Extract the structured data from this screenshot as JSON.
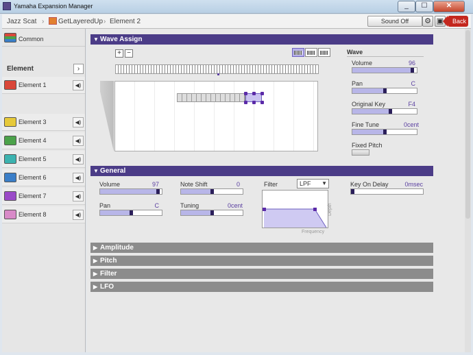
{
  "window": {
    "title": "Yamaha Expansion Manager",
    "min": "_",
    "max": "☐",
    "close": "✕"
  },
  "breadcrumb": {
    "root": "Jazz Scat",
    "item": "GetLayeredUp",
    "current": "Element 2",
    "sep": "›"
  },
  "toolbar": {
    "sound_off": "Sound Off",
    "gear": "⚙",
    "save": "▣",
    "back": "Back"
  },
  "sidebar": {
    "common": "Common",
    "element_heading": "Element",
    "next": "›",
    "speaker": "◀)",
    "elements": [
      {
        "label": "Element 1",
        "color": "#d9473a"
      },
      {
        "label": "Element 2",
        "color": "#ea7a2e"
      },
      {
        "label": "Element 3",
        "color": "#e6c93a"
      },
      {
        "label": "Element 4",
        "color": "#4ba24a"
      },
      {
        "label": "Element 5",
        "color": "#3cb3b0"
      },
      {
        "label": "Element 6",
        "color": "#3a7ec8"
      },
      {
        "label": "Element 7",
        "color": "#9a4ac8"
      },
      {
        "label": "Element 8",
        "color": "#d88ac8"
      }
    ]
  },
  "wave_assign": {
    "header": "Wave Assign",
    "plus": "+",
    "minus": "−",
    "wave": {
      "heading": "Wave",
      "volume": {
        "label": "Volume",
        "value": "96",
        "level": 0.96
      },
      "pan": {
        "label": "Pan",
        "value": "C",
        "level": 0.5
      },
      "original_key": {
        "label": "Original Key",
        "value": "F4",
        "level": 0.6
      },
      "fine_tune": {
        "label": "Fine Tune",
        "value": "0cent",
        "level": 0.5
      },
      "fixed_pitch": {
        "label": "Fixed Pitch"
      }
    }
  },
  "general": {
    "header": "General",
    "volume": {
      "label": "Volume",
      "value": "97",
      "level": 0.97
    },
    "note_shift": {
      "label": "Note Shift",
      "value": "0",
      "level": 0.5
    },
    "pan": {
      "label": "Pan",
      "value": "C",
      "level": 0.5
    },
    "tuning": {
      "label": "Tuning",
      "value": "0cent",
      "level": 0.5
    },
    "filter": {
      "label": "Filter",
      "type": "LPF",
      "axis_x": "Frequency",
      "axis_y": "Depth"
    },
    "key_on_delay": {
      "label": "Key On Delay",
      "value": "0msec",
      "level": 0.0
    }
  },
  "collapsed_sections": [
    "Amplitude",
    "Pitch",
    "Filter",
    "LFO"
  ],
  "accent_color": "#4b3c87"
}
